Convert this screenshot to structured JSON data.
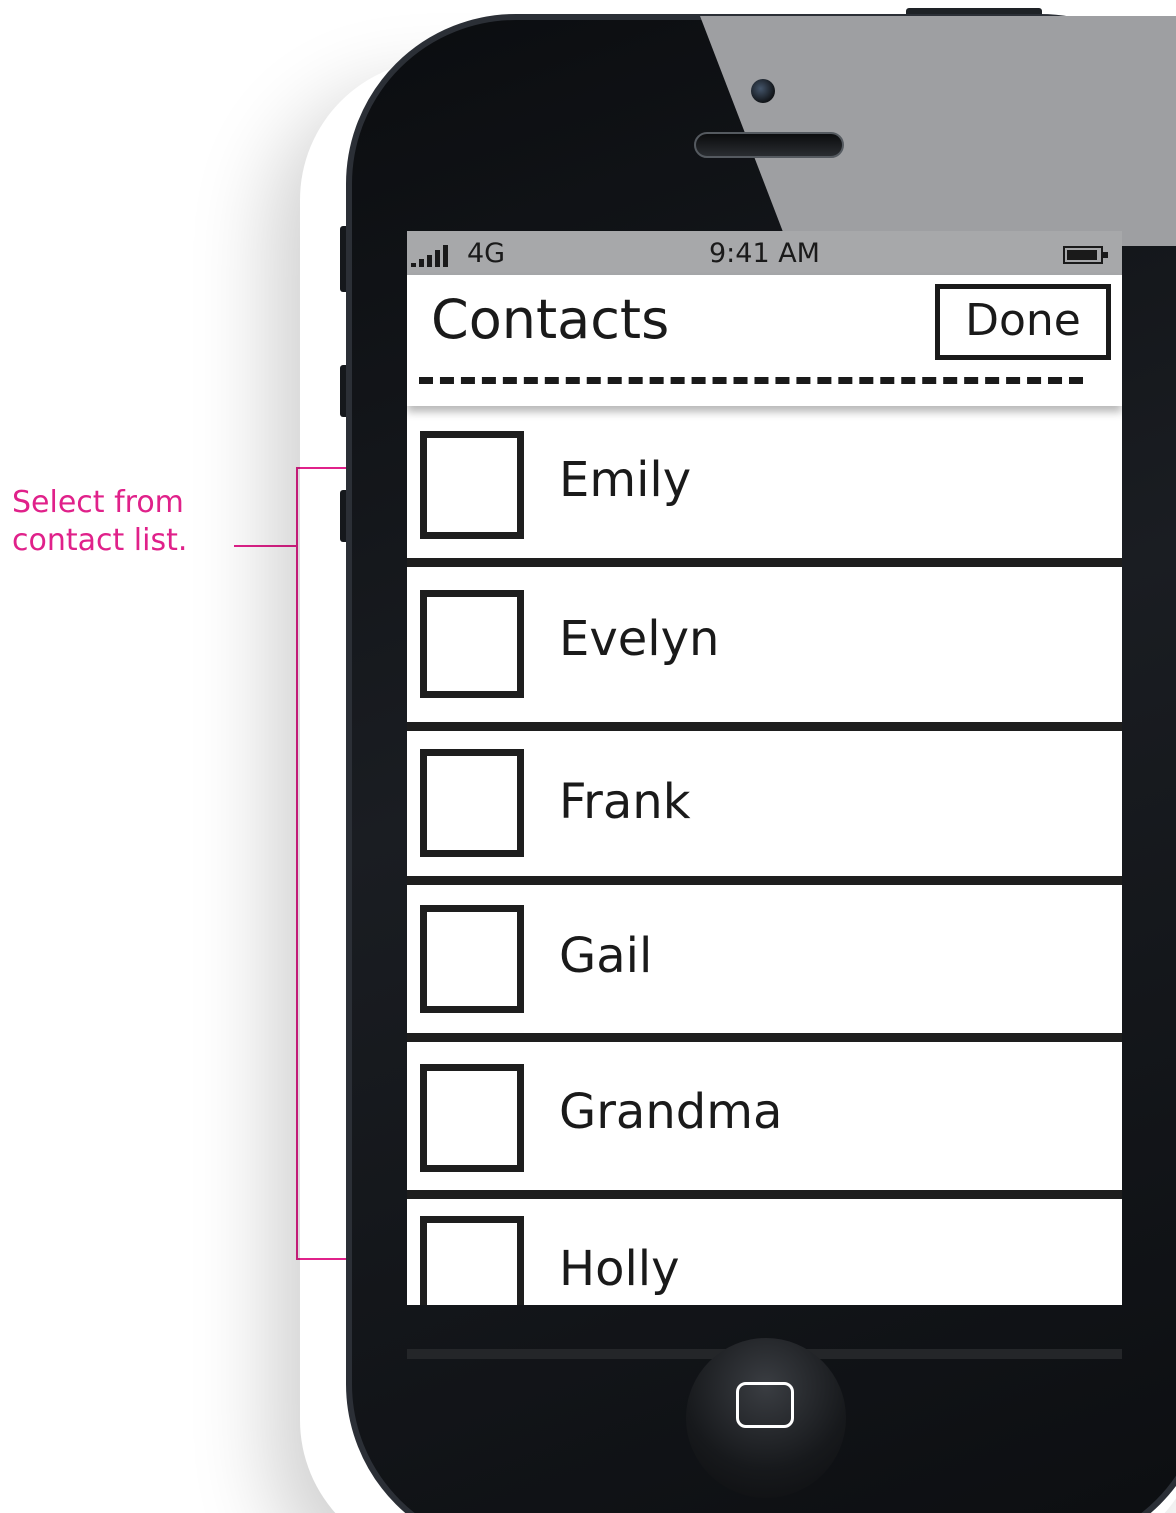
{
  "annotation": {
    "text": "Select from\ncontact list.",
    "color": "#e0218a"
  },
  "status_bar": {
    "network": "4G",
    "time": "9:41 AM"
  },
  "nav": {
    "title": "Contacts",
    "done_label": "Done"
  },
  "contacts": [
    {
      "name": "Emily",
      "checked": false
    },
    {
      "name": "Evelyn",
      "checked": false
    },
    {
      "name": "Frank",
      "checked": false
    },
    {
      "name": "Gail",
      "checked": false
    },
    {
      "name": "Grandma",
      "checked": false
    },
    {
      "name": "Holly",
      "checked": false
    }
  ]
}
